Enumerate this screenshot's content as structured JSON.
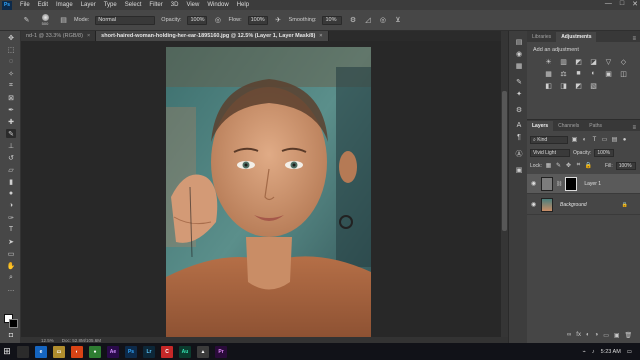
{
  "menubar": {
    "logo": "Ps",
    "items": [
      "File",
      "Edit",
      "Image",
      "Layer",
      "Type",
      "Select",
      "Filter",
      "3D",
      "View",
      "Window",
      "Help"
    ],
    "window_controls": [
      "—",
      "□",
      "✕"
    ]
  },
  "options": {
    "brush_size": "500",
    "mode_label": "Mode:",
    "mode_value": "Normal",
    "opacity_label": "Opacity:",
    "opacity_value": "100%",
    "flow_label": "Flow:",
    "flow_value": "100%",
    "smoothing_label": "Smoothing:",
    "smoothing_value": "10%"
  },
  "tabs": [
    {
      "label": "nd-1 @ 33.3% (RGB/8)",
      "close": "×"
    },
    {
      "label": "short-haired-woman-holding-her-ear-1895160.jpg @ 12.5% (Layer 1, Layer Mask/8)",
      "close": "×"
    }
  ],
  "status": {
    "zoom": "12.5%",
    "doc": "Doc: 52.8M/105.6M"
  },
  "panel": {
    "tabs": [
      "Libraries",
      "Adjustments"
    ],
    "active_tab": "Adjustments",
    "menu": "≡",
    "add_adjustment": "Add an adjustment",
    "adjustment_icons": [
      "☀",
      "▥",
      "◩",
      "◪",
      "▽",
      "◇",
      "▦",
      "⚖",
      "■",
      "◐",
      "▣",
      "◫",
      "◧",
      "◨",
      "◩",
      "▧"
    ]
  },
  "layers_panel": {
    "tabs": [
      "Layers",
      "Channels",
      "Paths"
    ],
    "active_tab": "Layers",
    "menu": "≡",
    "kind_label": "Kind",
    "blend_mode": "Vivid Light",
    "opacity_label": "Opacity:",
    "opacity_value": "100%",
    "lock_label": "Lock:",
    "fill_label": "Fill:",
    "fill_value": "100%",
    "layers": [
      {
        "name": "Layer 1",
        "selected": true
      },
      {
        "name": "Background",
        "selected": false
      }
    ],
    "actions": [
      "∞",
      "fx",
      "◐",
      "◑",
      "▭",
      "▣",
      "🗑"
    ]
  },
  "taskbar": {
    "start": "⊞",
    "apps": [
      {
        "label": "",
        "color": "#2b2b2b"
      },
      {
        "label": "e",
        "color": "#1565c0"
      },
      {
        "label": "▭",
        "color": "#b08d2e"
      },
      {
        "label": "◐",
        "color": "#d84315"
      },
      {
        "label": "●",
        "color": "#2e7d32"
      },
      {
        "label": "Ae",
        "color": "#2a0b4a"
      },
      {
        "label": "Ps",
        "color": "#0d2a4a"
      },
      {
        "label": "Lr",
        "color": "#0d2738"
      },
      {
        "label": "C",
        "color": "#c62828"
      },
      {
        "label": "Au",
        "color": "#0b3b2e"
      },
      {
        "label": "▲",
        "color": "#3b3b3b"
      },
      {
        "label": "Pr",
        "color": "#2a0b3a"
      }
    ],
    "time": "5:23 AM"
  },
  "colors": {
    "accent": "#31a8ff",
    "teal_background": "#4a7e7c",
    "skin": "#d39a76"
  }
}
